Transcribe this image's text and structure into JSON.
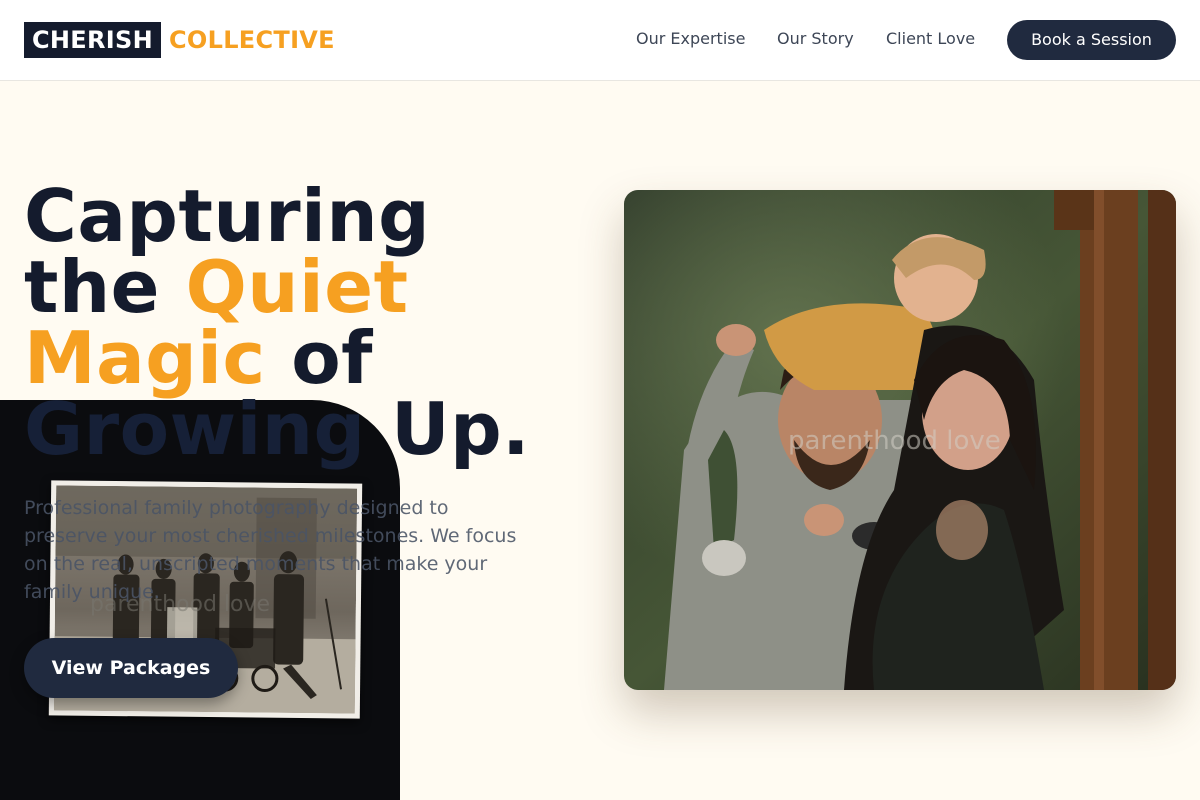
{
  "header": {
    "logo": {
      "part1": "CHERISH",
      "part2": "COLLECTIVE"
    },
    "nav": [
      "Our Expertise",
      "Our Story",
      "Client Love"
    ],
    "cta_label": "Book a Session"
  },
  "hero": {
    "title_parts": [
      "Capturing",
      "the",
      "Quiet",
      "Magic",
      "of",
      "Growing",
      "Up."
    ],
    "subtitle": "Professional family photography designed to preserve your most cherished milestones. We focus on the real, unscripted moments that make your family unique.",
    "cta_label": "View Packages"
  },
  "images": {
    "family_caption": "parenthood love",
    "vintage_caption": "parenthood love"
  },
  "colors": {
    "accent": "#f6a021",
    "navy": "#141b2d",
    "button": "#202a3f",
    "background": "#fffbf2"
  }
}
